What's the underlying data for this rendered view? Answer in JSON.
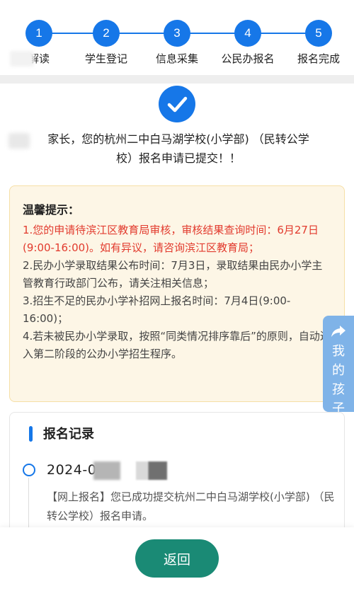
{
  "stepper": {
    "steps": [
      {
        "num": "1",
        "label": "解读"
      },
      {
        "num": "2",
        "label": "学生登记"
      },
      {
        "num": "3",
        "label": "信息采集"
      },
      {
        "num": "4",
        "label": "公民办报名"
      },
      {
        "num": "5",
        "label": "报名完成"
      }
    ]
  },
  "result": {
    "message_line1": "家长，您的杭州二中白马湖学校(小学部) （民转公学",
    "message_line2": "校）报名申请已提交！！"
  },
  "tips": {
    "title": "温馨提示：",
    "items": [
      "1.您的申请待滨江区教育局审核，审核结果查询时间：6月27日(9:00-16:00)。如有异议，请咨询滨江区教育局；",
      "2.民办小学录取结果公布时间：7月3日，录取结果由民办小学主管教育行政部门公布，请关注相关信息；",
      "3.招生不足的民办小学补招网上报名时间：7月4日(9:00-16:00)；",
      "4.若未被民办小学录取，按照“同类情况排序靠后”的原则，自动进入第二阶段的公办小学招生程序。"
    ]
  },
  "float_button": {
    "icon": "share-arrow-icon",
    "label_chars": [
      "我",
      "的",
      "孩",
      "子"
    ]
  },
  "records": {
    "title": "报名记录",
    "entries": [
      {
        "date": "2024-0",
        "text": "【网上报名】您已成功提交杭州二中白马湖学校(小学部) （民转公学校）报名申请。"
      }
    ]
  },
  "footer": {
    "back_label": "返回"
  },
  "colors": {
    "primary": "#1677e8",
    "alert_red": "#e23b2e",
    "tips_bg": "#fdf6e6",
    "button_green": "#1a8a75",
    "float_bg": "#7fb3e8"
  }
}
